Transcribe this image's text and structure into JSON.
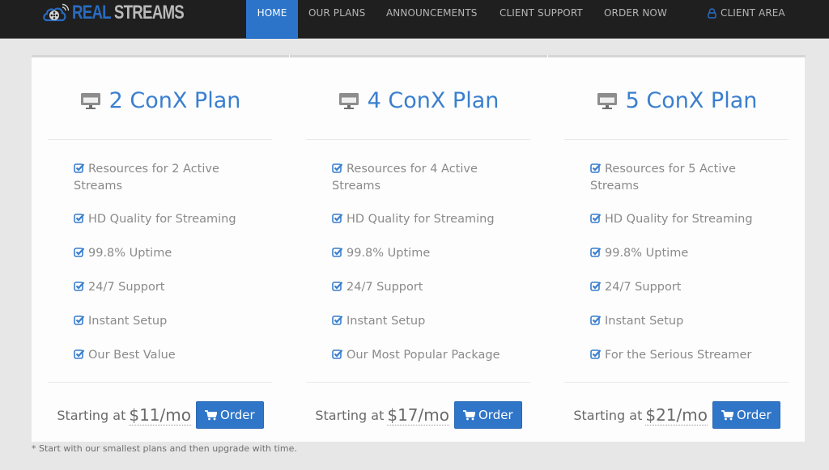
{
  "brand": {
    "name_part1": "REAL",
    "name_part2": "STREAMS",
    "logo_icon": "cloud-film-reel-icon"
  },
  "nav": {
    "items": [
      {
        "label": "HOME",
        "active": true
      },
      {
        "label": "OUR PLANS",
        "active": false
      },
      {
        "label": "ANNOUNCEMENTS",
        "active": false
      },
      {
        "label": "CLIENT SUPPORT",
        "active": false
      },
      {
        "label": "ORDER NOW",
        "active": false
      }
    ],
    "client_area": {
      "label": "CLIENT AREA",
      "icon": "user-lock-icon"
    }
  },
  "plans": [
    {
      "title": "2 ConX Plan",
      "icon": "monitor-icon",
      "features": [
        "Resources for 2 Active Streams",
        "HD Quality for Streaming",
        "99.8% Uptime",
        "24/7 Support",
        "Instant Setup",
        "Our Best Value"
      ],
      "starting_label": "Starting at",
      "price": "$11/mo",
      "order_label": "Order"
    },
    {
      "title": "4 ConX Plan",
      "icon": "monitor-icon",
      "features": [
        "Resources for 4 Active Streams",
        "HD Quality for Streaming",
        "99.8% Uptime",
        "24/7 Support",
        "Instant Setup",
        "Our Most Popular Package"
      ],
      "starting_label": "Starting at",
      "price": "$17/mo",
      "order_label": "Order"
    },
    {
      "title": "5 ConX Plan",
      "icon": "monitor-icon",
      "features": [
        "Resources for 5 Active Streams",
        "HD Quality for Streaming",
        "99.8% Uptime",
        "24/7 Support",
        "Instant Setup",
        "For the Serious Streamer"
      ],
      "starting_label": "Starting at",
      "price": "$21/mo",
      "order_label": "Order"
    }
  ],
  "footnote": "* Start with our smallest plans and then upgrade with time.",
  "colors": {
    "accent": "#2b74c9",
    "navbar_bg": "#1f1f1f",
    "title_blue": "#3a7fcf",
    "page_bg": "#e7e7e7"
  }
}
